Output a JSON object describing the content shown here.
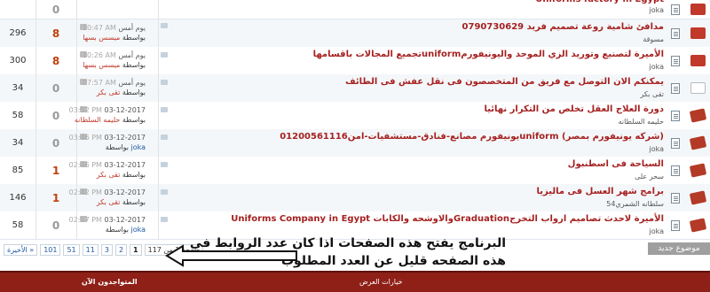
{
  "topics": [
    {
      "views": "",
      "replies": "0",
      "replies_hot": false,
      "last_date": "",
      "last_time": "",
      "last_by_prefix": "",
      "last_by": "",
      "last_by_blue": false,
      "title": "Uniforms factory in Egypt",
      "author": "joka",
      "status": "red"
    },
    {
      "views": "296",
      "replies": "8",
      "replies_hot": true,
      "last_date": "يوم أمس",
      "last_time": "10:47 AM",
      "last_by_prefix": "بواسطة",
      "last_by": "ميسس بسها",
      "last_by_blue": false,
      "title": "مدافئ شامية روعة تصميم فريد 0790730629",
      "author": "مسوقة",
      "status": "red"
    },
    {
      "views": "300",
      "replies": "8",
      "replies_hot": true,
      "last_date": "يوم أمس",
      "last_time": "10:26 AM",
      "last_by_prefix": "بواسطة",
      "last_by": "ميسس بسها",
      "last_by_blue": false,
      "title": "الأميرة لتصنيع وتوريد الزي الموحد واليونيفورمuniformتجميع المجالات باقسامها",
      "author": "joka",
      "status": "red"
    },
    {
      "views": "34",
      "replies": "0",
      "replies_hot": false,
      "last_date": "يوم أمس",
      "last_time": "07:57 AM",
      "last_by_prefix": "بواسطة",
      "last_by": "تقى بكر",
      "last_by_blue": false,
      "title": "يمكنكم الان التوصل مع فريق من المتخصصون فى نقل عفش فى الطائف",
      "author": "تقى بكر",
      "status": "white"
    },
    {
      "views": "58",
      "replies": "0",
      "replies_hot": false,
      "last_date": "03-12-2017",
      "last_time": "03:52 PM",
      "last_by_prefix": "بواسطة",
      "last_by": "حليمه السلطانه",
      "last_by_blue": false,
      "title": "دورة العلاج العقل تخلص من التكرار نهائيا",
      "author": "حليمه السلطانه",
      "status": "red2"
    },
    {
      "views": "34",
      "replies": "0",
      "replies_hot": false,
      "last_date": "03-12-2017",
      "last_time": "03:46 PM",
      "last_by_prefix": "بواسطة",
      "last_by": "joka",
      "last_by_blue": true,
      "title": "(شركه يونيفورم بمصر) uniformيونيفورم مصانع-فنادق-مستشفيات-امن01200561116",
      "author": "joka",
      "status": "red2"
    },
    {
      "views": "85",
      "replies": "1",
      "replies_hot": true,
      "last_date": "03-12-2017",
      "last_time": "02:46 PM",
      "last_by_prefix": "بواسطة",
      "last_by": "تقى بكر",
      "last_by_blue": false,
      "title": "السياحة فى اسطنبول",
      "author": "سحر على",
      "status": "red2"
    },
    {
      "views": "146",
      "replies": "1",
      "replies_hot": true,
      "last_date": "03-12-2017",
      "last_time": "02:42 PM",
      "last_by_prefix": "بواسطة",
      "last_by": "تقى بكر",
      "last_by_blue": false,
      "title": "برامج شهر العسل فى ماليزيا",
      "author": "سلطانه الشمري54",
      "status": "red2"
    },
    {
      "views": "58",
      "replies": "0",
      "replies_hot": false,
      "last_date": "03-12-2017",
      "last_time": "02:17 PM",
      "last_by_prefix": "بواسطة",
      "last_by": "joka",
      "last_by_blue": true,
      "title": "الأميرة لاحدث تصاميم ارواب التخرجGraduationوالاوشحه والكابات Uniforms Company in Egypt",
      "author": "joka",
      "status": "red2"
    }
  ],
  "pagination": {
    "last": "الأخيرة »",
    "pages": [
      "101",
      "51",
      "11",
      "3",
      "2",
      "1"
    ],
    "current": "1",
    "summary": "صفحة 1 من 117"
  },
  "new_topic_button": "موضوع جديد",
  "footer": {
    "online_users": "المتواجدون الآن",
    "display_options": "خيارات العرض"
  },
  "annotation": "البرنامج يفتح هذه الصفحات اذا كان عدد الروابط في هذه الصفحه قليل عن العدد المطلوب"
}
